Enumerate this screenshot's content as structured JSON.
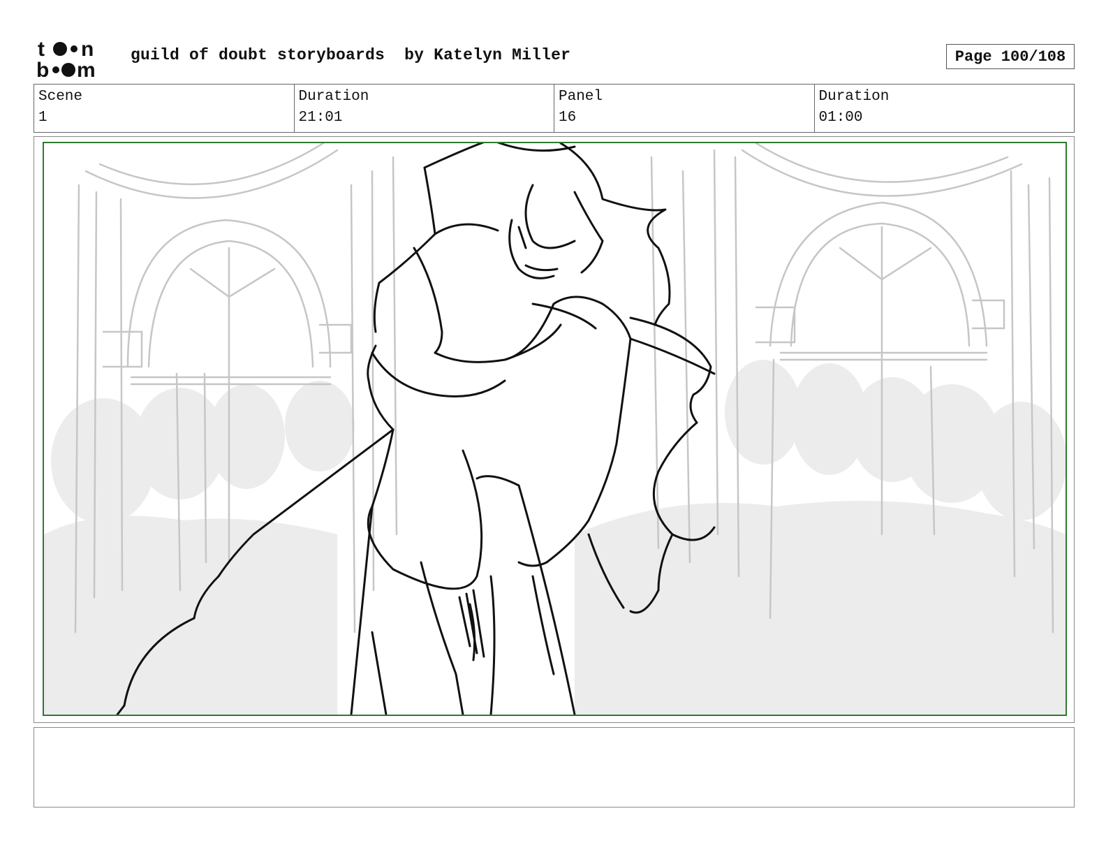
{
  "header": {
    "logo_top": "to•n",
    "logo_bottom": "b••m",
    "title": "guild of doubt storyboards  by Katelyn Miller",
    "page": "Page 100/108"
  },
  "info": {
    "scene_label": "Scene",
    "scene_value": "1",
    "duration_label": "Duration",
    "duration_value": "21:01",
    "panel_label": "Panel",
    "panel_value": "16",
    "panel_duration_label": "Duration",
    "panel_duration_value": "01:00"
  },
  "notes": {
    "text": ""
  },
  "colors": {
    "frame_green": "#2e7a2e",
    "background_sketch": "#c8c8c8",
    "crowd_fill": "#ececec",
    "ink": "#111111"
  }
}
